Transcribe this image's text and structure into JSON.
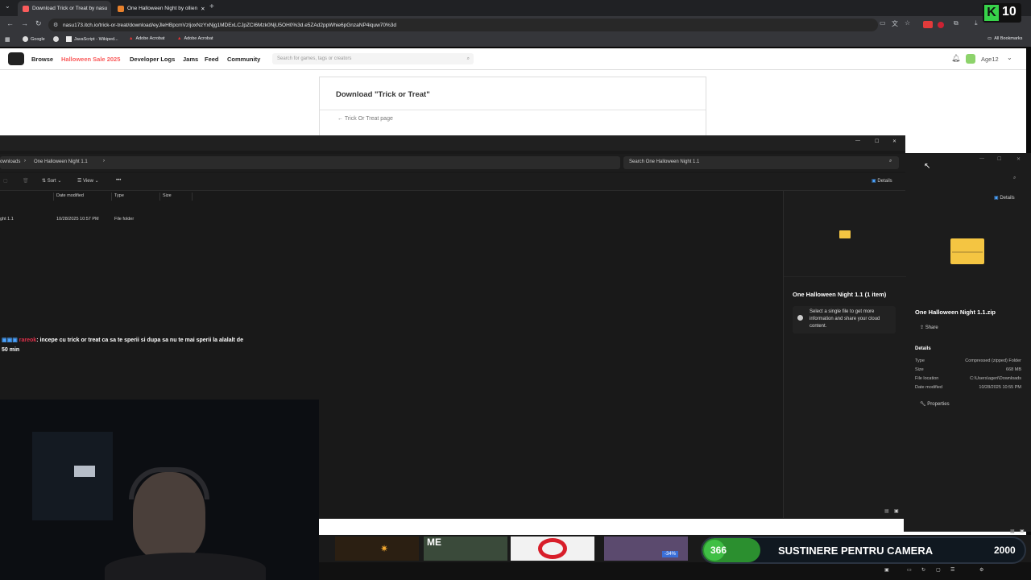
{
  "browser": {
    "tabs": [
      {
        "title": "Download Trick or Treat by nasu",
        "active": true
      },
      {
        "title": "One Halloween Night by ollien",
        "active": false
      }
    ],
    "url": "nasu173.itch.io/trick-or-treat/download/eyJleHBpcmVzIjoxNzYxNjg1MDExLCJpZCI6Mzk0NjU5OH0%3d.e5ZAd2ppWhie6pGnzaNP4iquw70%3d",
    "bookmarks": [
      "Google",
      "JavaScript - Wikiped...",
      "Adobe Acrobat",
      "Adobe Acrobat"
    ],
    "all_bookmarks": "All Bookmarks"
  },
  "itch": {
    "nav": [
      "Browse",
      "Halloween Sale 2025",
      "Developer Logs",
      "Jams",
      "Feed",
      "Community"
    ],
    "search_placeholder": "Search for games, tags or creators",
    "user": "Age12",
    "download_title": "Download \"Trick or Treat\"",
    "back_link": "← Trick Or Treat page"
  },
  "explorer": {
    "breadcrumb": [
      "ownloads",
      "One Halloween Night 1.1"
    ],
    "search_placeholder": "Search One Halloween Night 1.1",
    "toolbar": {
      "sort": "Sort",
      "view": "View",
      "more": "•••",
      "details": "Details"
    },
    "columns": [
      "Date modified",
      "Type",
      "Size"
    ],
    "rows": [
      {
        "name": "ght 1.1",
        "date": "10/28/2025 10:57 PM",
        "type": "File folder"
      }
    ],
    "details_title": "One Halloween Night 1.1 (1 item)",
    "details_msg": "Select a single file to get more information and share your cloud content."
  },
  "explorer2": {
    "details": "Details",
    "file_name": "One Halloween Night 1.1.zip",
    "share": "Share",
    "section": "Details",
    "props": [
      {
        "k": "Type",
        "v": "Compressed (zipped) Folder"
      },
      {
        "k": "Size",
        "v": "668 MB"
      },
      {
        "k": "File location",
        "v": "C:\\Users\\ageri\\Downloads"
      },
      {
        "k": "Date modified",
        "v": "10/28/2025 10:55 PM"
      }
    ],
    "properties": "Properties"
  },
  "chat": {
    "user": "rareok",
    "message": ": incepe cu trick or treat ca sa te sperii si dupa sa nu te mai sperii la alalalt de 50 min"
  },
  "overlay": {
    "left_count": "366",
    "title": "SUSTINERE PENTRU CAMERA",
    "goal": "2000",
    "progress": 0.18,
    "logo_number": "10",
    "thumb_label": "ME",
    "thumb_badge": "-34%"
  }
}
